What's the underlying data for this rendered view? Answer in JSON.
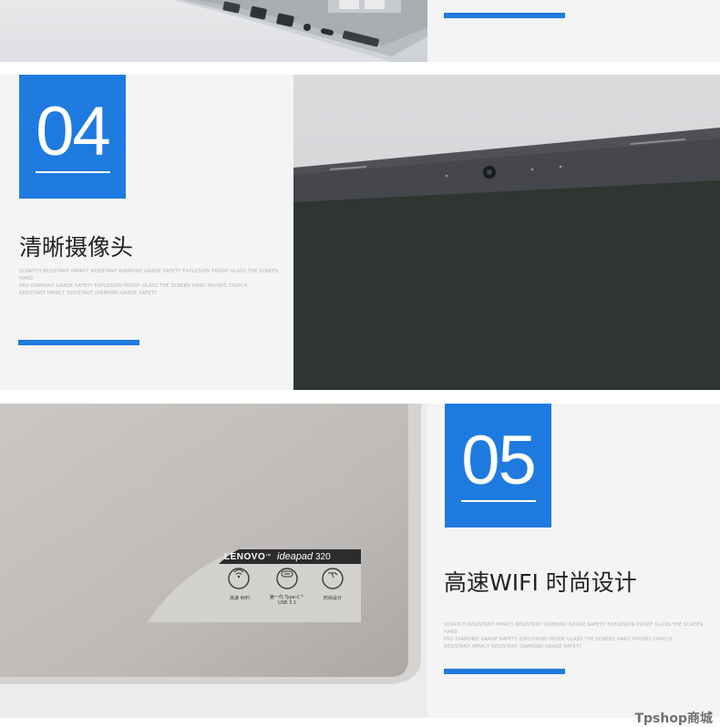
{
  "section_top": {},
  "section_04": {
    "number": "04",
    "title": "清晰摄像头",
    "fine_print": [
      "SCRATCH RESISTANT IMPACT RESISTANT DIAMOND GRADE SAFETY EXPLOSION PROOF GLASS THE SCREEN HARD",
      "PRO DIAMOND GRADE SAFETY EXPLOSION PROOF GLASS THE SCREEN HARD PROSPS CRATCH",
      "RESISTANT IMPACT RESISTANT DIAMOND GRADE SAFETY"
    ]
  },
  "section_05": {
    "number": "05",
    "title": "高速WIFI 时尚设计",
    "fine_print": [
      "SCRATCH RESISTANT IMPACT RESISTANT DIAMOND GRADE SAFETY EXPLOSION PROOF GLASS THE SCREEN HARD",
      "PRO DIAMOND GRADE SAFETY EXPLOSION PROOF GLASS THE SCREEN HARD PROSPS CRATCH",
      "RESISTANT IMPACT RESISTANT DIAMOND GRADE SAFETY"
    ]
  },
  "badge": {
    "brand": "LENOVO",
    "trademark": "™",
    "model": "ideapad",
    "model_number": "320",
    "features": [
      {
        "icon": "wifi-icon",
        "label": "高速 WiFi"
      },
      {
        "icon": "usb-c-icon",
        "label": "第一代 Type-C™ USB 3.1"
      },
      {
        "icon": "stylus-icon",
        "label": "时尚设计"
      }
    ]
  },
  "watermark": "Tpshop商城",
  "colors": {
    "accent": "#1f7ae0",
    "panel": "#f4f4f4"
  }
}
